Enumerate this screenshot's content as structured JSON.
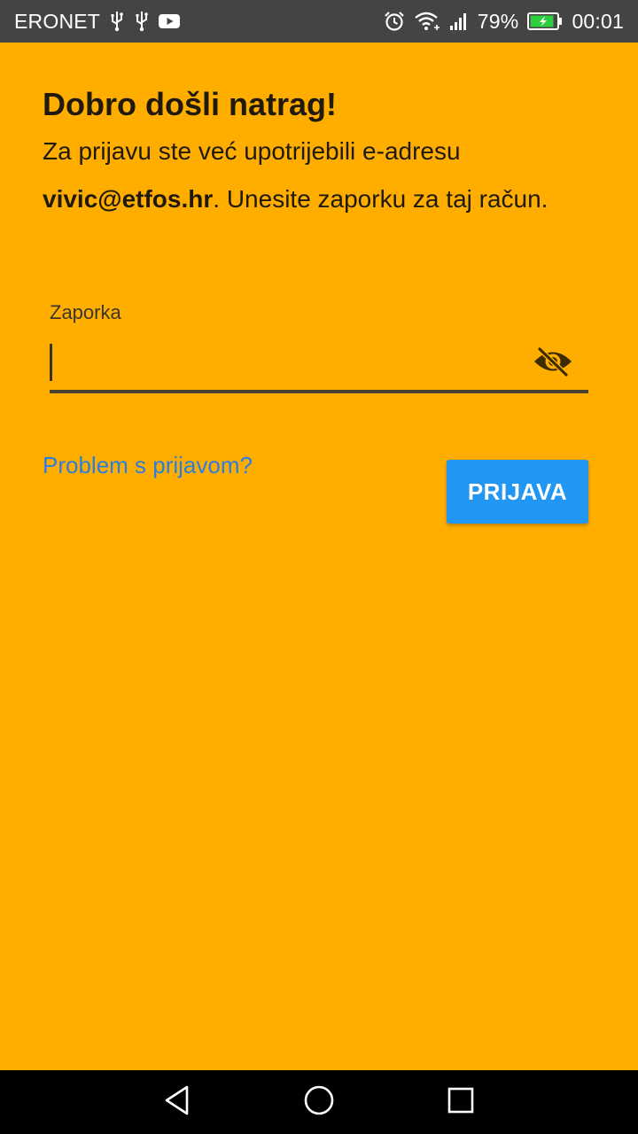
{
  "status_bar": {
    "carrier": "ERONET",
    "left_icons": [
      "usb-icon",
      "usb-icon",
      "youtube-icon"
    ],
    "right_icons": [
      "alarm-icon",
      "wifi-icon",
      "signal-icon"
    ],
    "battery": "79%",
    "time": "00:01"
  },
  "welcome": {
    "title": "Dobro došli natrag!",
    "text_before": "Za prijavu ste već upotrijebili e-adresu ",
    "email": "vivic@etfos.hr",
    "text_after": ". Unesite zaporku za taj račun."
  },
  "password_field": {
    "label": "Zaporka",
    "value": "",
    "toggle_icon": "eye-off-icon"
  },
  "links": {
    "problem": "Problem s prijavom?"
  },
  "buttons": {
    "login": "PRIJAVA"
  },
  "navigation": {
    "icons": [
      "back-icon",
      "home-icon",
      "recents-icon"
    ]
  },
  "colors": {
    "background": "#FFAE00",
    "status_bar": "#444444",
    "button": "#2196F3",
    "link": "#2A7EE0"
  }
}
